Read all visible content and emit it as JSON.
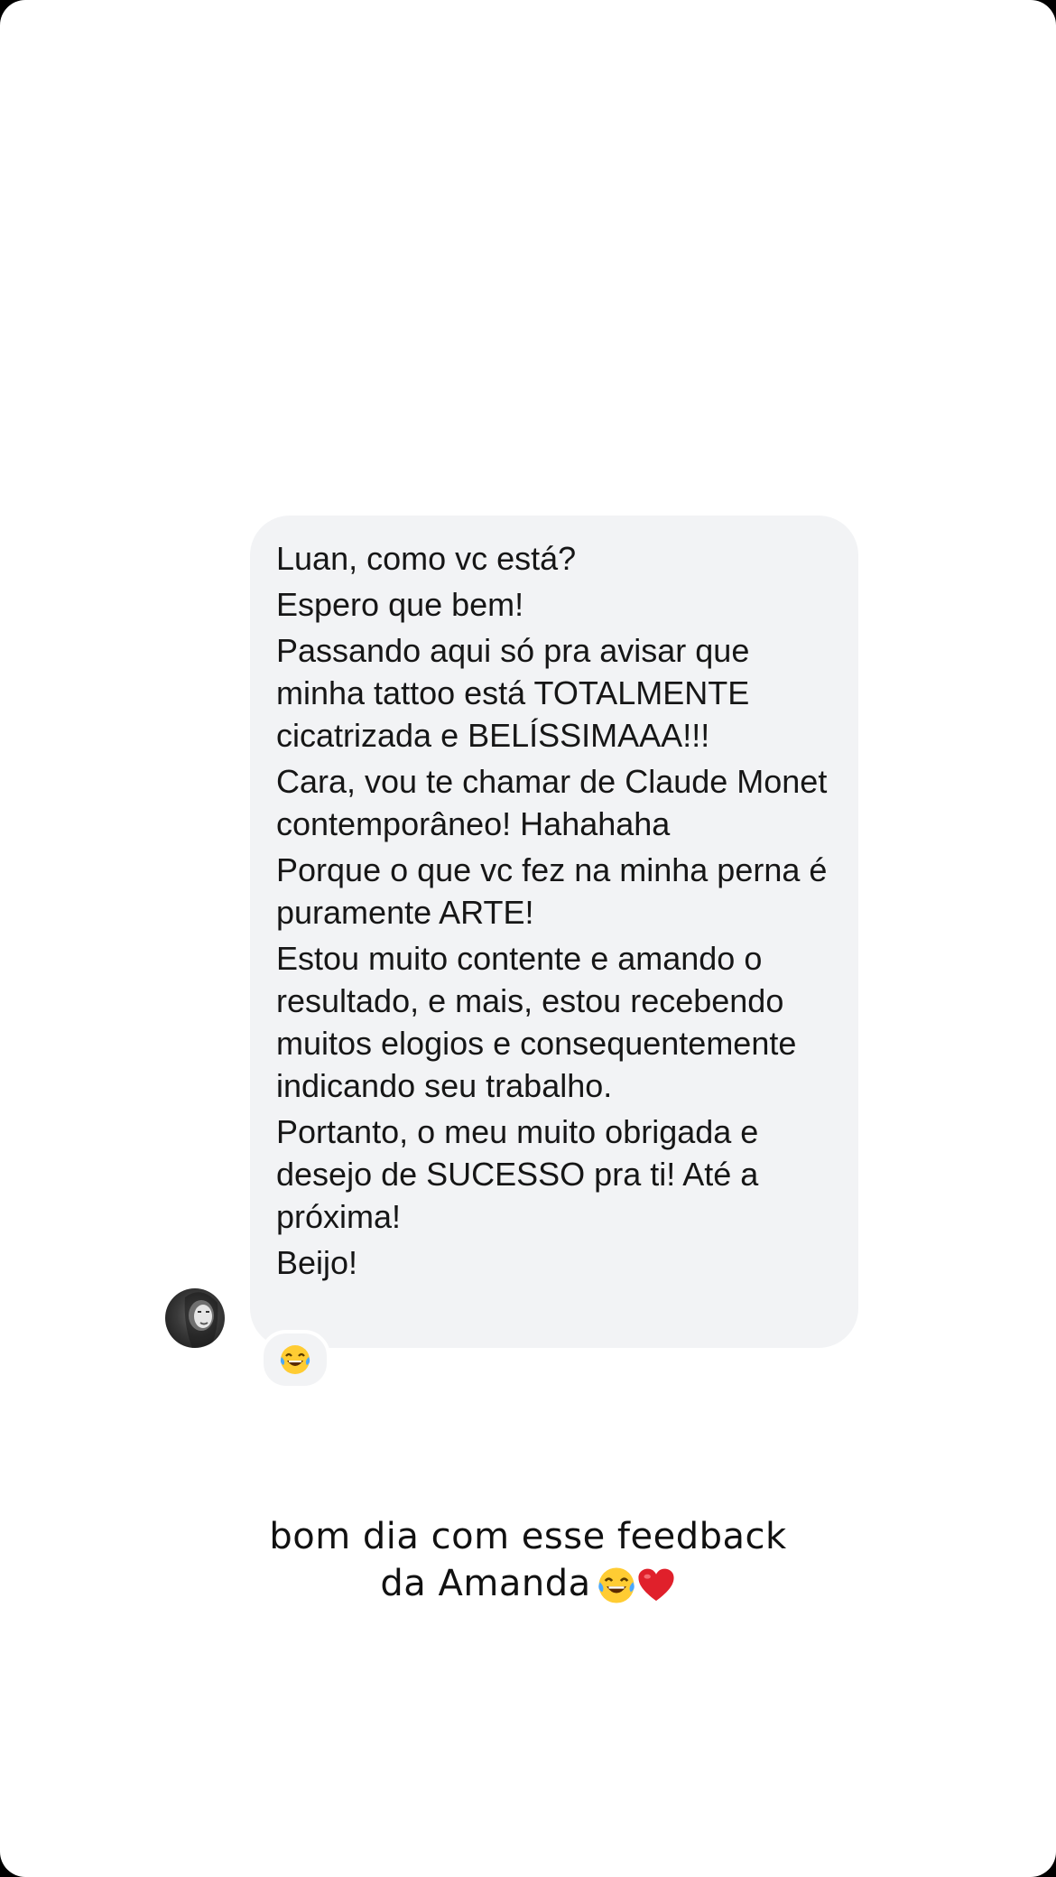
{
  "message": {
    "lines": [
      "Luan, como vc está?",
      "Espero que bem!",
      "Passando aqui só pra avisar que minha tattoo está TOTALMENTE cicatrizada e BELÍSSIMAAA!!!",
      "Cara, vou te chamar de Claude Monet contemporâneo! Hahahaha",
      "Porque o que vc fez na minha perna é puramente ARTE!",
      "Estou muito contente e amando o resultado, e mais, estou recebendo muitos elogios e consequentemente indicando seu trabalho.",
      "Portanto, o meu muito obrigada e desejo de SUCESSO pra ti! Até a próxima!",
      "Beijo!"
    ],
    "reaction_icon": "laughing-tears-emoji"
  },
  "caption": {
    "line1": "bom dia com esse feedback",
    "line2": "da Amanda",
    "icons": [
      "laughing-tears-emoji",
      "red-heart-emoji"
    ]
  },
  "colors": {
    "bubble": "#f2f3f5",
    "background": "#ffffff",
    "text": "#161616"
  }
}
